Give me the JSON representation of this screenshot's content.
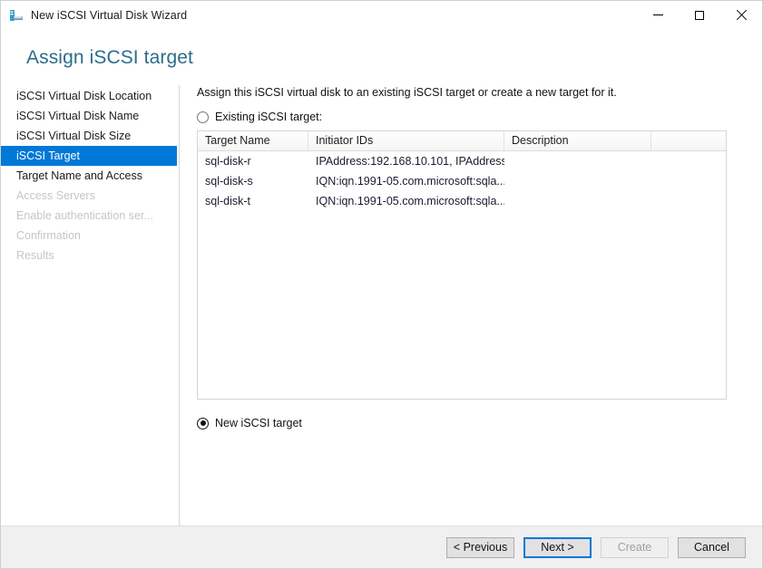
{
  "window": {
    "title": "New iSCSI Virtual Disk Wizard",
    "icon": "iscsi-disk-icon",
    "minimize_label": "Minimize",
    "maximize_label": "Maximize",
    "close_label": "Close"
  },
  "page": {
    "title": "Assign iSCSI target"
  },
  "nav": {
    "items": [
      {
        "label": "iSCSI Virtual Disk Location",
        "state": "normal"
      },
      {
        "label": "iSCSI Virtual Disk Name",
        "state": "normal"
      },
      {
        "label": "iSCSI Virtual Disk Size",
        "state": "normal"
      },
      {
        "label": "iSCSI Target",
        "state": "selected"
      },
      {
        "label": "Target Name and Access",
        "state": "normal"
      },
      {
        "label": "Access Servers",
        "state": "disabled"
      },
      {
        "label": "Enable authentication ser...",
        "state": "disabled"
      },
      {
        "label": "Confirmation",
        "state": "disabled"
      },
      {
        "label": "Results",
        "state": "disabled"
      }
    ]
  },
  "main": {
    "intro": "Assign this iSCSI virtual disk to an existing iSCSI target or create a new target for it.",
    "existing_radio_label": "Existing iSCSI target:",
    "existing_radio_checked": false,
    "new_radio_label": "New iSCSI target",
    "new_radio_checked": true,
    "table": {
      "columns": [
        "Target Name",
        "Initiator IDs",
        "Description"
      ],
      "rows": [
        {
          "target_name": "sql-disk-r",
          "initiator_ids": "IPAddress:192.168.10.101, IPAddress:...",
          "description": ""
        },
        {
          "target_name": "sql-disk-s",
          "initiator_ids": "IQN:iqn.1991-05.com.microsoft:sqla....",
          "description": ""
        },
        {
          "target_name": "sql-disk-t",
          "initiator_ids": "IQN:iqn.1991-05.com.microsoft:sqla....",
          "description": ""
        }
      ]
    }
  },
  "footer": {
    "previous_label": "< Previous",
    "next_label": "Next >",
    "create_label": "Create",
    "cancel_label": "Cancel",
    "create_disabled": true
  },
  "colors": {
    "accent": "#0078d7",
    "title_text": "#2a6d8a",
    "footer_bg": "#f0f0f0"
  }
}
